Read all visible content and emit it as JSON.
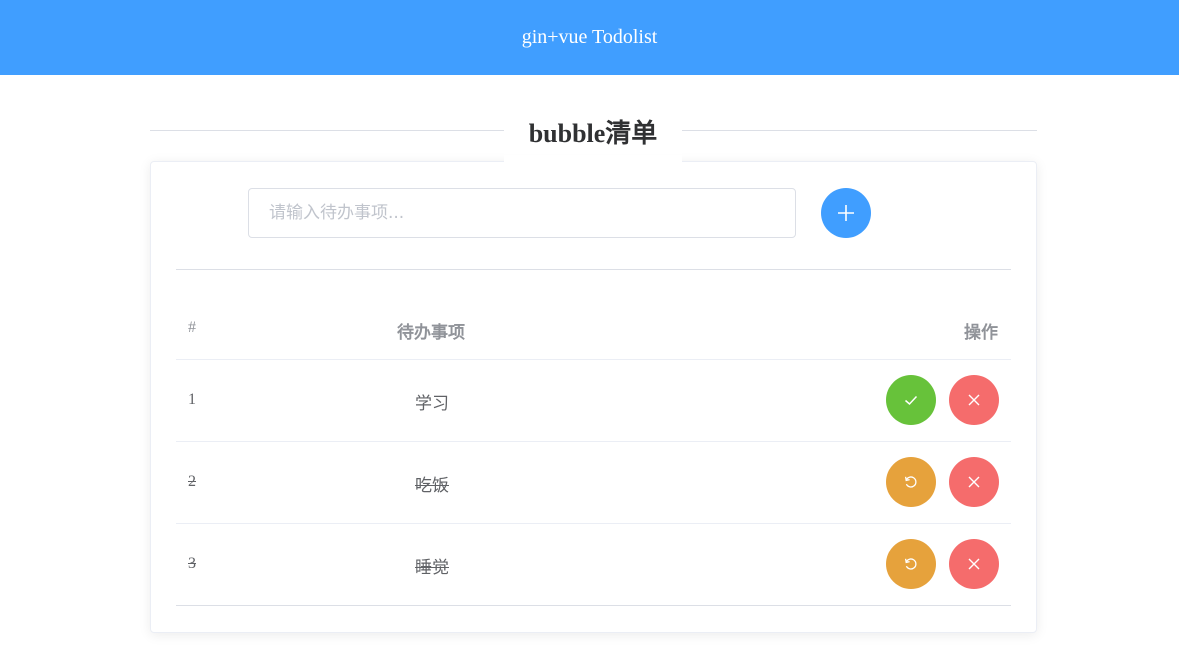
{
  "header": {
    "title": "gin+vue Todolist"
  },
  "page": {
    "heading": "bubble清单"
  },
  "input": {
    "placeholder": "请输入待办事项..."
  },
  "table": {
    "columns": {
      "index": "#",
      "item": "待办事项",
      "actions": "操作"
    },
    "rows": [
      {
        "index": "1",
        "title": "学习",
        "status": "pending"
      },
      {
        "index": "2",
        "title": "吃饭",
        "status": "done"
      },
      {
        "index": "3",
        "title": "睡觉",
        "status": "done"
      }
    ]
  },
  "icons": {
    "add": "plus-icon",
    "complete": "check-icon",
    "restore": "refresh-icon",
    "delete": "close-icon"
  },
  "colors": {
    "primary": "#409eff",
    "success": "#67c23a",
    "warning": "#e6a23c",
    "danger": "#f56c6c"
  }
}
